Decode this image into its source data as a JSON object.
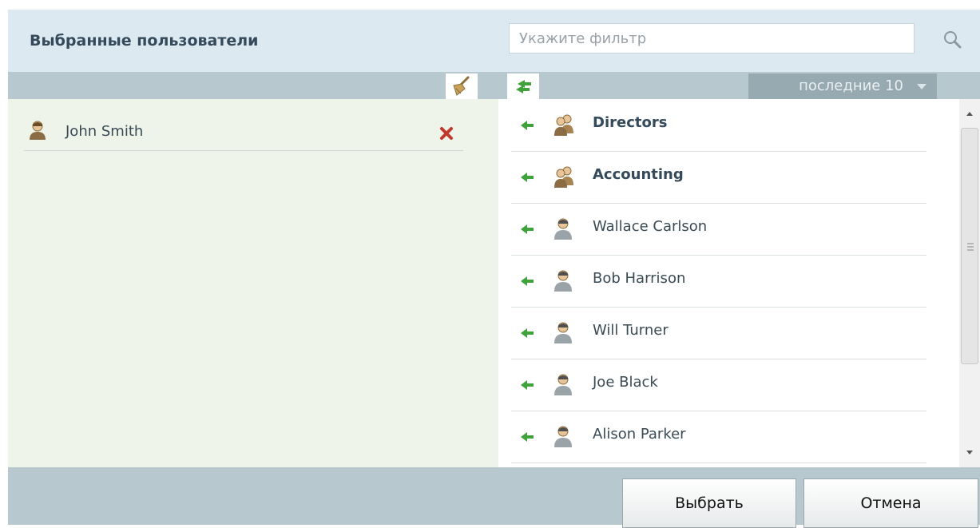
{
  "header": {
    "title": "Выбранные пользователи",
    "filter_placeholder": "Укажите фильтр"
  },
  "toolbar": {
    "recent_label": "последние 10"
  },
  "selected": [
    {
      "name": "John Smith",
      "icon": "user-icon"
    }
  ],
  "users": [
    {
      "name": "Directors",
      "type": "group",
      "icon": "group-icon"
    },
    {
      "name": "Accounting",
      "type": "group",
      "icon": "group-icon"
    },
    {
      "name": "Wallace Carlson",
      "type": "user",
      "icon": "user-icon"
    },
    {
      "name": "Bob Harrison",
      "type": "user",
      "icon": "user-icon"
    },
    {
      "name": "Will Turner",
      "type": "user",
      "icon": "user-icon"
    },
    {
      "name": "Joe Black",
      "type": "user",
      "icon": "user-icon"
    },
    {
      "name": "Alison Parker",
      "type": "user",
      "icon": "user-icon"
    }
  ],
  "buttons": {
    "select": "Выбрать",
    "cancel": "Отмена"
  },
  "colors": {
    "header_bg": "#dde9f0",
    "toolbar_bg": "#b8c8cf",
    "selected_panel_bg": "#eef4e9",
    "arrow_green": "#3fa23a",
    "remove_red": "#c0392b"
  }
}
